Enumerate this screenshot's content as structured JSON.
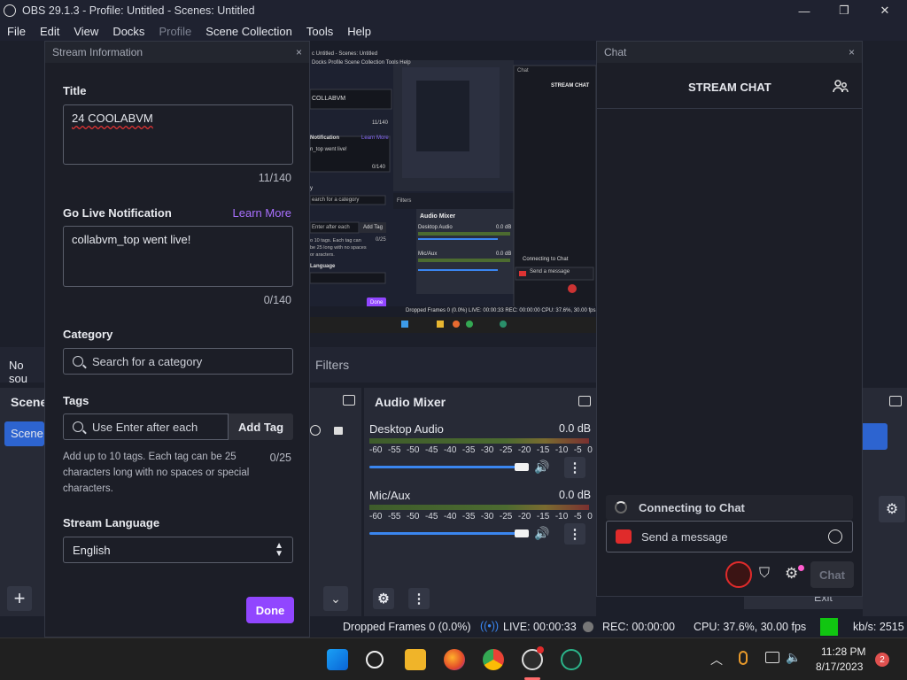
{
  "window": {
    "title": "OBS 29.1.3 - Profile: Untitled - Scenes: Untitled",
    "minimize": "—",
    "maximize": "❐",
    "close": "✕"
  },
  "menu": [
    "File",
    "Edit",
    "View",
    "Docks",
    "Profile",
    "Scene Collection",
    "Tools",
    "Help"
  ],
  "stream_info": {
    "panel_title": "Stream Information",
    "close": "×",
    "title_label": "Title",
    "title_value": "24 COOLABVM",
    "title_count": "11/140",
    "notif_label": "Go Live Notification",
    "learn_more": "Learn More",
    "notif_value": "collabvm_top went live!",
    "notif_count": "0/140",
    "category_label": "Category",
    "category_placeholder": "Search for a category",
    "tags_label": "Tags",
    "tags_placeholder": "Use Enter after each",
    "add_tag": "Add Tag",
    "tags_help": "Add up to 10 tags. Each tag can be 25 characters long with no spaces or special characters.",
    "tags_count": "0/25",
    "language_label": "Stream Language",
    "language_value": "English",
    "done": "Done"
  },
  "preview_mini": {
    "title": "c Untitled - Scenes: Untitled",
    "menu": "Docks  Profile  Scene Collection  Tools  Help",
    "titlefield": "COLLABVM",
    "count1": "11/140",
    "notif": "Notification",
    "learn": "Learn More",
    "notifval": "n_top went live!",
    "count2": "0/140",
    "y": "y",
    "catsearch": "earch for a category",
    "tagph": "Enter after each",
    "addtag": "Add Tag",
    "taghelp": "o 10 tags. Each tag can be 25 long with no spaces or aracters.",
    "tagcount": "0/25",
    "lang": "Language",
    "done": "Done",
    "chat": "Chat",
    "streamchat": "STREAM CHAT",
    "filters": "Filters",
    "mixer": "Audio Mixer",
    "desktop": "Desktop Audio",
    "desktopdb": "0.0 dB",
    "mic": "Mic/Aux",
    "micdb": "0.0 dB",
    "connecting": "Connecting to Chat",
    "send": "Send a message",
    "status": "Dropped Frames 0 (0.0%)   LIVE: 00:00:33   REC: 00:00:00   CPU: 37.6%, 30.00 fps"
  },
  "obs": {
    "no_source": "No sou",
    "filters": "Filters",
    "scenes_dock": "Scene",
    "scene_item": "Scene",
    "add": "+",
    "exit": "Exit"
  },
  "audio_mixer": {
    "title": "Audio Mixer",
    "scale": [
      "-60",
      "-55",
      "-50",
      "-45",
      "-40",
      "-35",
      "-30",
      "-25",
      "-20",
      "-15",
      "-10",
      "-5",
      "0"
    ],
    "channels": [
      {
        "name": "Desktop Audio",
        "db": "0.0 dB",
        "volume": 1.0
      },
      {
        "name": "Mic/Aux",
        "db": "0.0 dB",
        "volume": 1.0
      }
    ],
    "menu": "⋮"
  },
  "chat": {
    "panel_title": "Chat",
    "close": "×",
    "header": "STREAM CHAT",
    "connecting": "Connecting to Chat",
    "send_placeholder": "Send a message",
    "chat_button": "Chat"
  },
  "status": {
    "dropped": "Dropped Frames 0 (0.0%)",
    "live": "LIVE: 00:00:33",
    "rec": "REC: 00:00:00",
    "cpu": "CPU: 37.6%, 30.00 fps",
    "kbs": "kb/s: 2515"
  },
  "taskbar": {
    "time": "11:28 PM",
    "date": "8/17/2023",
    "notif_count": "2"
  }
}
